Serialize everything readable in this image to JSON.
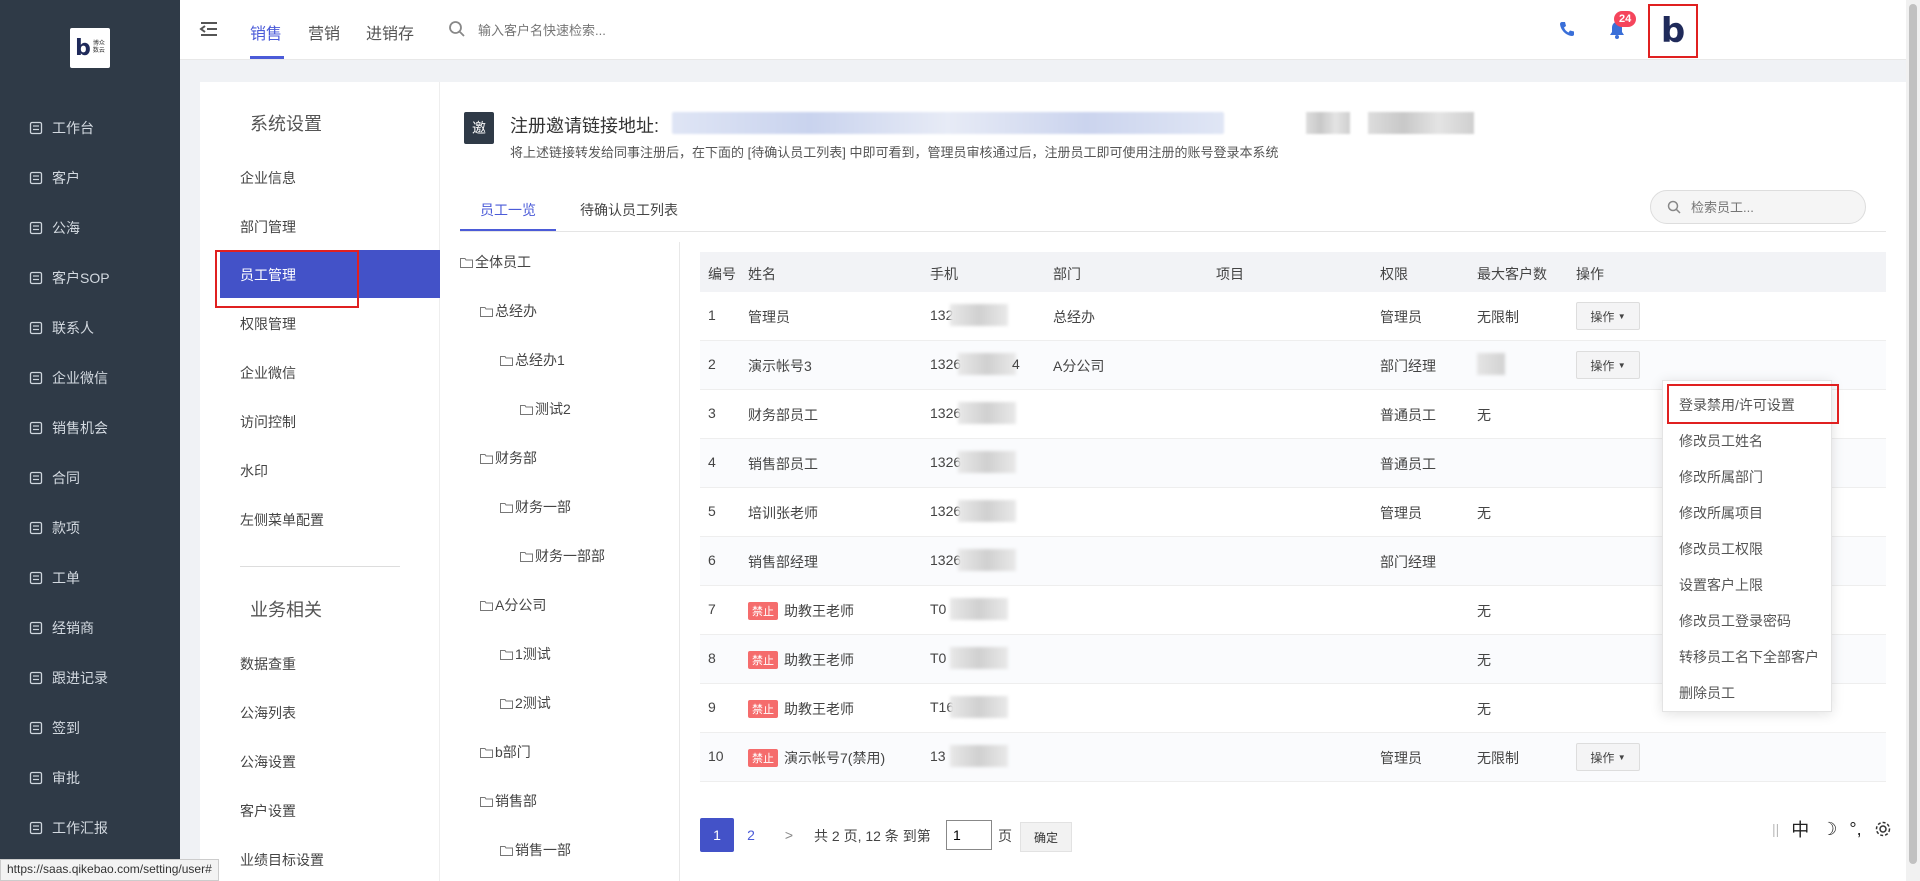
{
  "brand": {
    "logo_letter": "b",
    "logo_sub_line1": "博众",
    "logo_sub_line2": "数云"
  },
  "left_nav": {
    "items": [
      {
        "label": "工作台",
        "icon": "dashboard-icon"
      },
      {
        "label": "客户",
        "icon": "customer-icon"
      },
      {
        "label": "公海",
        "icon": "sea-icon"
      },
      {
        "label": "客户SOP",
        "icon": "sop-icon"
      },
      {
        "label": "联系人",
        "icon": "contact-icon"
      },
      {
        "label": "企业微信",
        "icon": "wechat-icon"
      },
      {
        "label": "销售机会",
        "icon": "opportunity-icon"
      },
      {
        "label": "合同",
        "icon": "contract-icon"
      },
      {
        "label": "款项",
        "icon": "payment-icon"
      },
      {
        "label": "工单",
        "icon": "ticket-icon"
      },
      {
        "label": "经销商",
        "icon": "dealer-icon"
      },
      {
        "label": "跟进记录",
        "icon": "followup-icon"
      },
      {
        "label": "签到",
        "icon": "checkin-icon"
      },
      {
        "label": "审批",
        "icon": "approval-icon"
      },
      {
        "label": "工作汇报",
        "icon": "report-icon"
      }
    ]
  },
  "header": {
    "tabs": [
      "销售",
      "营销",
      "进销存"
    ],
    "active_tab": "销售",
    "search_placeholder": "输入客户名快速检索...",
    "notification_count": "24",
    "avatar_letter": "b"
  },
  "settings_panel": {
    "section1_title": "系统设置",
    "section1_items": [
      "企业信息",
      "部门管理",
      "员工管理",
      "权限管理",
      "企业微信",
      "访问控制",
      "水印",
      "左侧菜单配置"
    ],
    "active_item": "员工管理",
    "section2_title": "业务相关",
    "section2_items": [
      "数据查重",
      "公海列表",
      "公海设置",
      "客户设置",
      "业绩目标设置"
    ]
  },
  "invite": {
    "icon_char": "邀",
    "title": "注册邀请链接地址:",
    "description": "将上述链接转发给同事注册后，在下面的 [待确认员工列表] 中即可看到，管理员审核通过后，注册员工即可使用注册的账号登录本系统"
  },
  "tabs": {
    "employee_list": "员工一览",
    "pending_list": "待确认员工列表"
  },
  "employee_search_placeholder": "检索员工...",
  "department_tree": [
    {
      "label": "全体员工",
      "level": 0
    },
    {
      "label": "总经办",
      "level": 1
    },
    {
      "label": "总经办1",
      "level": 2
    },
    {
      "label": "测试2",
      "level": 3
    },
    {
      "label": "财务部",
      "level": 1
    },
    {
      "label": "财务一部",
      "level": 2
    },
    {
      "label": "财务一部部",
      "level": 3
    },
    {
      "label": "A分公司",
      "level": 1
    },
    {
      "label": "1测试",
      "level": 2
    },
    {
      "label": "2测试",
      "level": 2
    },
    {
      "label": "b部门",
      "level": 1
    },
    {
      "label": "销售部",
      "level": 1
    },
    {
      "label": "销售一部",
      "level": 2
    }
  ],
  "table": {
    "columns": [
      "编号",
      "姓名",
      "手机",
      "部门",
      "项目",
      "权限",
      "最大客户数",
      "操作"
    ],
    "rows": [
      {
        "no": "1",
        "name": "管理员",
        "banned": false,
        "phone_prefix": "132",
        "dept": "总经办",
        "project": "",
        "role": "管理员",
        "max_customers": "无限制",
        "op": "操作"
      },
      {
        "no": "2",
        "name": "演示帐号3",
        "banned": false,
        "phone_prefix": "1326",
        "phone_suffix": "4",
        "dept": "A分公司",
        "project": "",
        "role": "部门经理",
        "max_customers": "",
        "op": "操作"
      },
      {
        "no": "3",
        "name": "财务部员工",
        "banned": false,
        "phone_prefix": "1326",
        "dept": "",
        "project": "",
        "role": "普通员工",
        "max_customers": "无",
        "op": ""
      },
      {
        "no": "4",
        "name": "销售部员工",
        "banned": false,
        "phone_prefix": "1326",
        "dept": "",
        "project": "",
        "role": "普通员工",
        "max_customers": "",
        "op": ""
      },
      {
        "no": "5",
        "name": "培训张老师",
        "banned": false,
        "phone_prefix": "1326",
        "dept": "",
        "project": "",
        "role": "管理员",
        "max_customers": "无",
        "op": ""
      },
      {
        "no": "6",
        "name": "销售部经理",
        "banned": false,
        "phone_prefix": "1326",
        "dept": "",
        "project": "",
        "role": "部门经理",
        "max_customers": "",
        "op": ""
      },
      {
        "no": "7",
        "name": "助教王老师",
        "banned": true,
        "phone_prefix": "T0",
        "dept": "",
        "project": "",
        "role": "",
        "max_customers": "无",
        "op": ""
      },
      {
        "no": "8",
        "name": "助教王老师",
        "banned": true,
        "phone_prefix": "T0",
        "dept": "",
        "project": "",
        "role": "",
        "max_customers": "无",
        "op": ""
      },
      {
        "no": "9",
        "name": "助教王老师",
        "banned": true,
        "phone_prefix": "T16",
        "dept": "",
        "project": "",
        "role": "",
        "max_customers": "无",
        "op": ""
      },
      {
        "no": "10",
        "name": "演示帐号7(禁用)",
        "banned": true,
        "phone_prefix": "13",
        "dept": "",
        "project": "",
        "role": "管理员",
        "max_customers": "无限制",
        "op": "操作"
      }
    ],
    "ban_label": "禁止"
  },
  "dropdown": {
    "items": [
      "登录禁用/许可设置",
      "修改员工姓名",
      "修改所属部门",
      "修改所属项目",
      "修改员工权限",
      "设置客户上限",
      "修改员工登录密码",
      "转移员工名下全部客户",
      "删除员工"
    ]
  },
  "pagination": {
    "pages": [
      "1",
      "2"
    ],
    "next": ">",
    "summary": "共 2 页, 12 条 到第",
    "page_input": "1",
    "page_unit": "页",
    "confirm": "确定"
  },
  "ime": {
    "chars": [
      "中",
      "☽",
      "°,"
    ]
  },
  "status_url": "https://saas.qikebao.com/setting/user#",
  "colors": {
    "accent": "#4352c8",
    "sidebar_bg": "#2f3a47",
    "highlight": "#e02020",
    "ban": "#f56c6c"
  }
}
